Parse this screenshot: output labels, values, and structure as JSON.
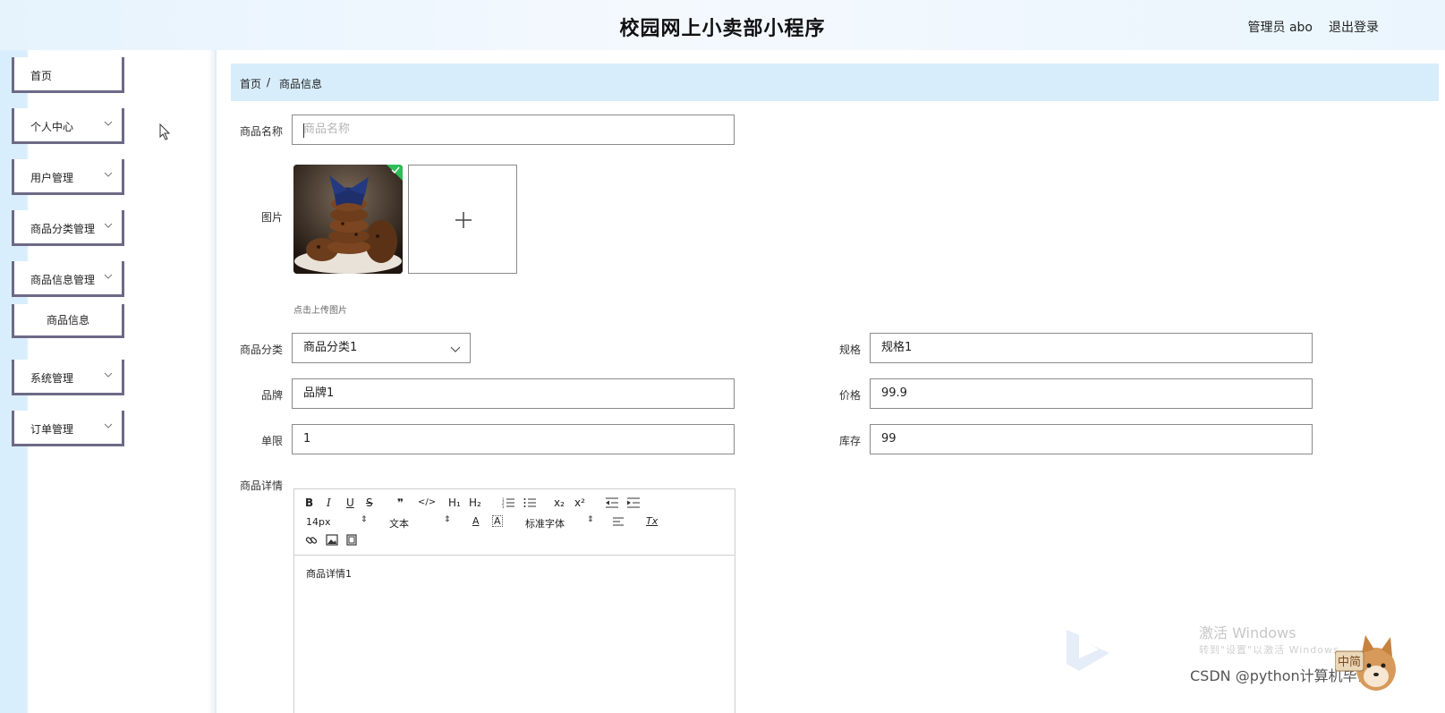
{
  "header": {
    "title": "校园网上小卖部小程序",
    "admin": "管理员 abo",
    "logout": "退出登录"
  },
  "sidebar": {
    "items": [
      {
        "label": "首页"
      },
      {
        "label": "个人中心"
      },
      {
        "label": "用户管理"
      },
      {
        "label": "商品分类管理"
      },
      {
        "label": "商品信息管理"
      },
      {
        "label": "商品信息"
      },
      {
        "label": "系统管理"
      },
      {
        "label": "订单管理"
      }
    ]
  },
  "breadcrumb": {
    "home": "首页",
    "sep": "/",
    "current": "商品信息"
  },
  "form": {
    "name_label": "商品名称",
    "name_placeholder": "商品名称",
    "image_label": "图片",
    "upload_tip": "点击上传图片",
    "category_label": "商品分类",
    "category_value": "商品分类1",
    "spec_label": "规格",
    "spec_value": "规格1",
    "brand_label": "品牌",
    "brand_value": "品牌1",
    "price_label": "价格",
    "price_value": "99.9",
    "limit_label": "单限",
    "limit_value": "1",
    "stock_label": "库存",
    "stock_value": "99",
    "detail_label": "商品详情"
  },
  "editor": {
    "toolbar": {
      "bold": "B",
      "italic": "I",
      "underline": "U",
      "strike": "S",
      "quote": "❞",
      "code": "</>",
      "h1": "H₁",
      "h2": "H₂",
      "sub": "x₂",
      "sup": "x²",
      "size": "14px",
      "header": "文本",
      "font": "标准字体",
      "clean": "Tx"
    },
    "content": "商品详情1"
  },
  "watermark": {
    "line1": "激活 Windows",
    "line2": "转到\"设置\"以激活 Windows。",
    "csdn": "CSDN @python计算机毕设",
    "badge": "中简"
  },
  "colors": {
    "sidebar_border": "#6d6a87",
    "breadcrumb_bg": "#d7edfc",
    "check_badge": "#2ebd59"
  }
}
